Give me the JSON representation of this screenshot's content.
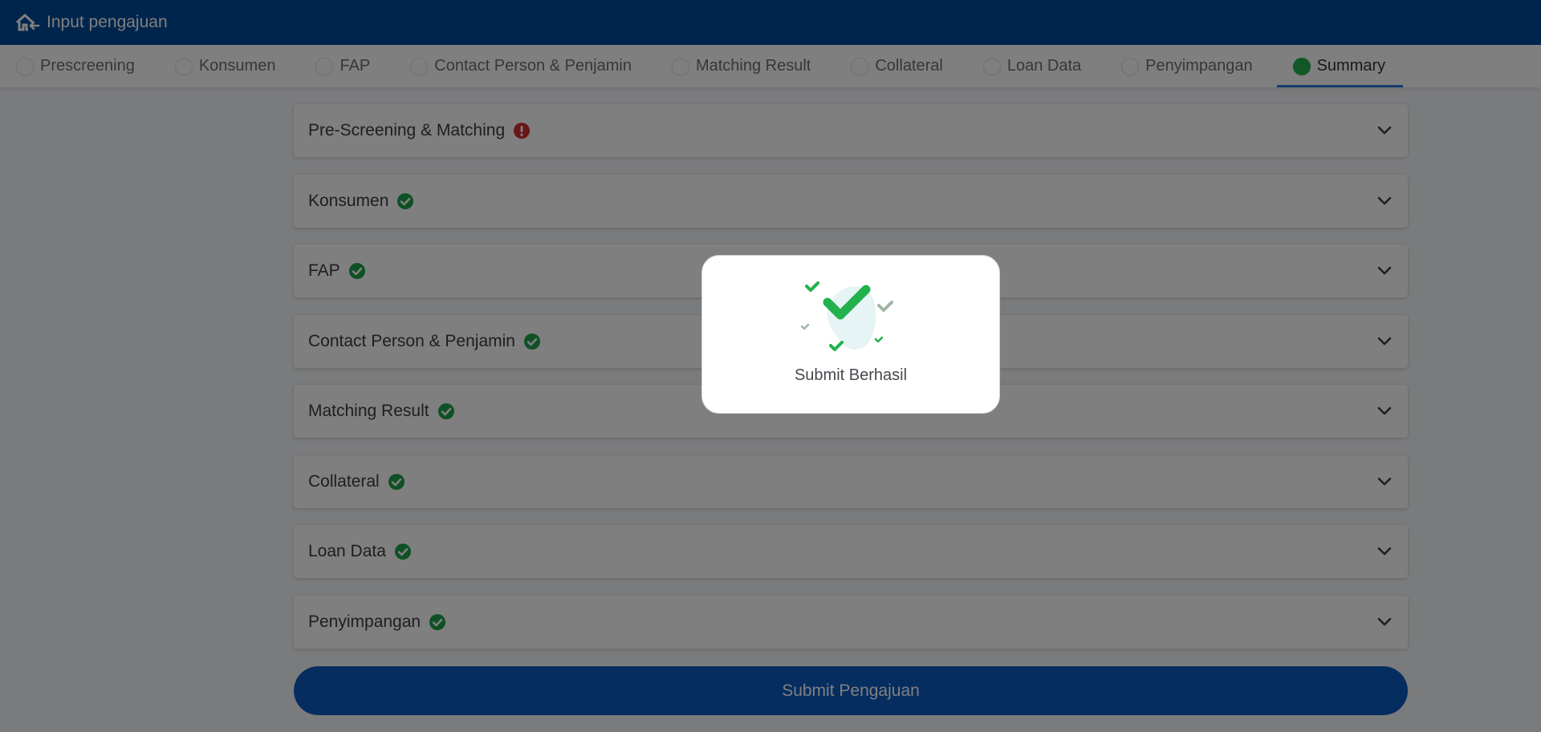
{
  "header": {
    "title": "Input pengajuan",
    "back_icon": "home-back-icon"
  },
  "steps": [
    {
      "label": "Prescreening",
      "active": false
    },
    {
      "label": "Konsumen",
      "active": false
    },
    {
      "label": "FAP",
      "active": false
    },
    {
      "label": "Contact Person & Penjamin",
      "active": false
    },
    {
      "label": "Matching Result",
      "active": false
    },
    {
      "label": "Collateral",
      "active": false
    },
    {
      "label": "Loan Data",
      "active": false
    },
    {
      "label": "Penyimpangan",
      "active": false
    },
    {
      "label": "Summary",
      "active": true
    }
  ],
  "sections": [
    {
      "title": "Pre-Screening & Matching",
      "status": "error"
    },
    {
      "title": "Konsumen",
      "status": "success"
    },
    {
      "title": "FAP",
      "status": "success"
    },
    {
      "title": "Contact Person & Penjamin",
      "status": "success"
    },
    {
      "title": "Matching Result",
      "status": "success"
    },
    {
      "title": "Collateral",
      "status": "success"
    },
    {
      "title": "Loan Data",
      "status": "success"
    },
    {
      "title": "Penyimpangan",
      "status": "success"
    }
  ],
  "submit_label": "Submit Pengajuan",
  "modal": {
    "message": "Submit Berhasil",
    "icon": "success-checks-icon"
  },
  "colors": {
    "header_bg": "#004a99",
    "active_step": "#22b14c",
    "active_underline": "#2f7ad8",
    "success": "#1fa14a",
    "error": "#d32f2f",
    "button_bg": "#0b5bc1"
  }
}
